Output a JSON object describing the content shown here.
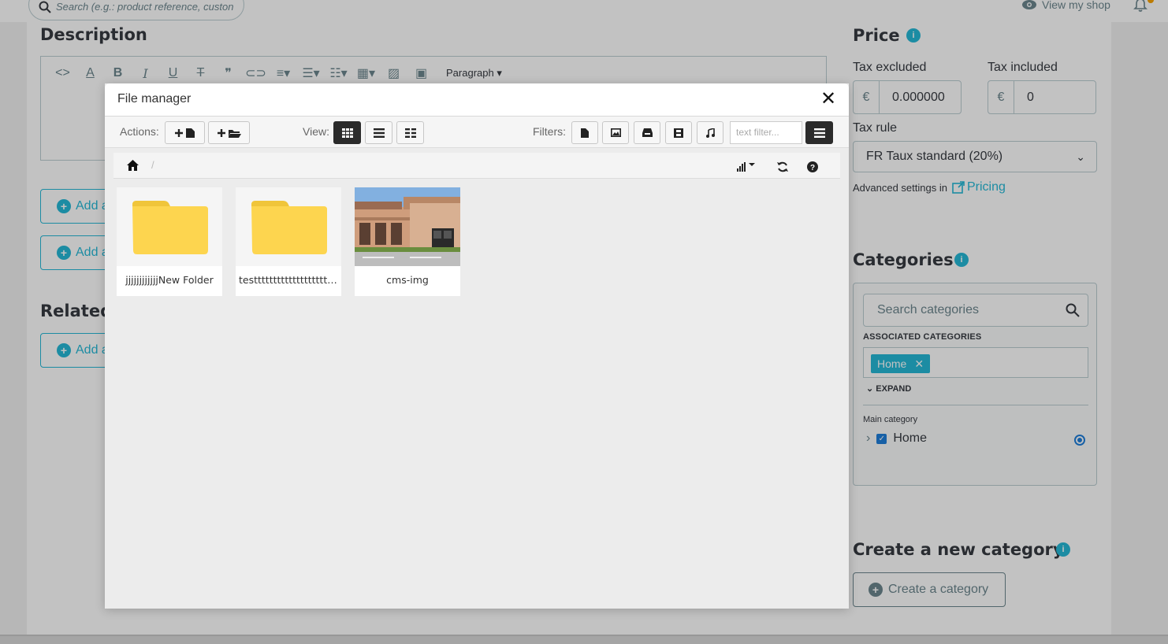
{
  "header": {
    "search_placeholder": "Search (e.g.: product reference, custon",
    "view_shop_label": "View my shop"
  },
  "description": {
    "title": "Description",
    "paragraph_label": "Paragraph"
  },
  "left_buttons": {
    "add_label_1": "Add a",
    "add_label_2": "Add a",
    "add_label_3": "Add a"
  },
  "related": {
    "title": "Related"
  },
  "price": {
    "title": "Price",
    "tax_excluded_label": "Tax excluded",
    "tax_included_label": "Tax included",
    "currency": "€",
    "tax_excluded_value": "0.000000",
    "tax_included_value": "0",
    "tax_rule_label": "Tax rule",
    "tax_rule_value": "FR Taux standard (20%)",
    "advanced_text": "Advanced settings in",
    "pricing_link": "Pricing"
  },
  "categories": {
    "title": "Categories",
    "search_placeholder": "Search categories",
    "associated_label": "ASSOCIATED CATEGORIES",
    "tags": [
      "Home"
    ],
    "expand_label": "EXPAND",
    "main_category_label": "Main category",
    "tree_item": "Home"
  },
  "new_category": {
    "title": "Create a new category",
    "button_label": "Create a category"
  },
  "file_manager": {
    "title": "File manager",
    "close": "✕",
    "actions_label": "Actions:",
    "view_label": "View:",
    "filters_label": "Filters:",
    "filter_placeholder": "text filter...",
    "breadcrumb_sep": "/",
    "items": [
      {
        "name": "jjjjjjjjjjjjNew Folder",
        "type": "folder"
      },
      {
        "name": "testttttttttttttttttttttN...",
        "type": "folder"
      },
      {
        "name": "cms-img",
        "type": "image"
      }
    ]
  },
  "colors": {
    "accent": "#25b9d7",
    "folder": "#fdd54f",
    "active_view": "#2b2b2b"
  }
}
